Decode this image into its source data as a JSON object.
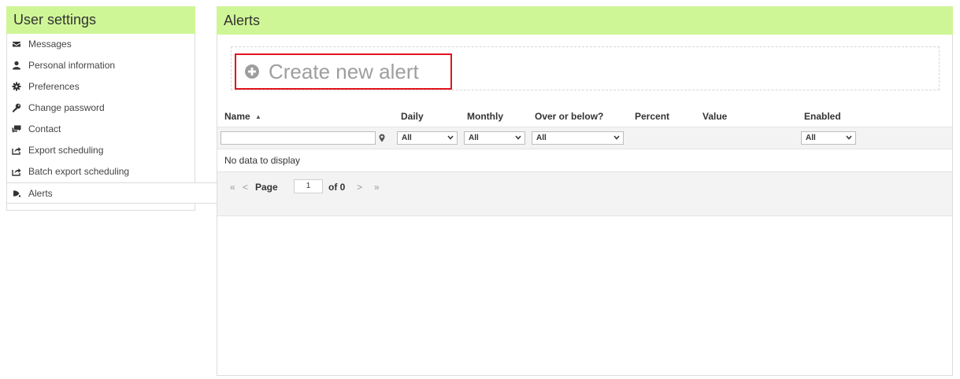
{
  "sidebar": {
    "title": "User settings",
    "items": [
      {
        "label": "Messages",
        "icon": "envelope-icon"
      },
      {
        "label": "Personal information",
        "icon": "user-icon"
      },
      {
        "label": "Preferences",
        "icon": "gear-icon"
      },
      {
        "label": "Change password",
        "icon": "key-icon"
      },
      {
        "label": "Contact",
        "icon": "chat-icon"
      },
      {
        "label": "Export scheduling",
        "icon": "share-icon"
      },
      {
        "label": "Batch export scheduling",
        "icon": "share-icon"
      },
      {
        "label": "Alerts",
        "icon": "bell-icon",
        "active": true
      }
    ]
  },
  "main": {
    "title": "Alerts",
    "create_button": {
      "label": "Create new alert",
      "icon": "plus-circle-icon"
    },
    "highlight_color": "#e0141e",
    "header_color": "#cff696"
  },
  "grid": {
    "columns": {
      "name": "Name",
      "daily": "Daily",
      "monthly": "Monthly",
      "over_below": "Over or below?",
      "percent": "Percent",
      "value": "Value",
      "enabled": "Enabled"
    },
    "sort_indicator": "▲",
    "filters": {
      "name_value": "",
      "daily": "All",
      "monthly": "All",
      "over_below": "All",
      "enabled": "All"
    },
    "empty_message": "No data to display"
  },
  "pager": {
    "first": "«",
    "prev": "<",
    "label": "Page",
    "current": "1",
    "of_text": "of",
    "total": "0",
    "next": ">",
    "last": "»"
  }
}
